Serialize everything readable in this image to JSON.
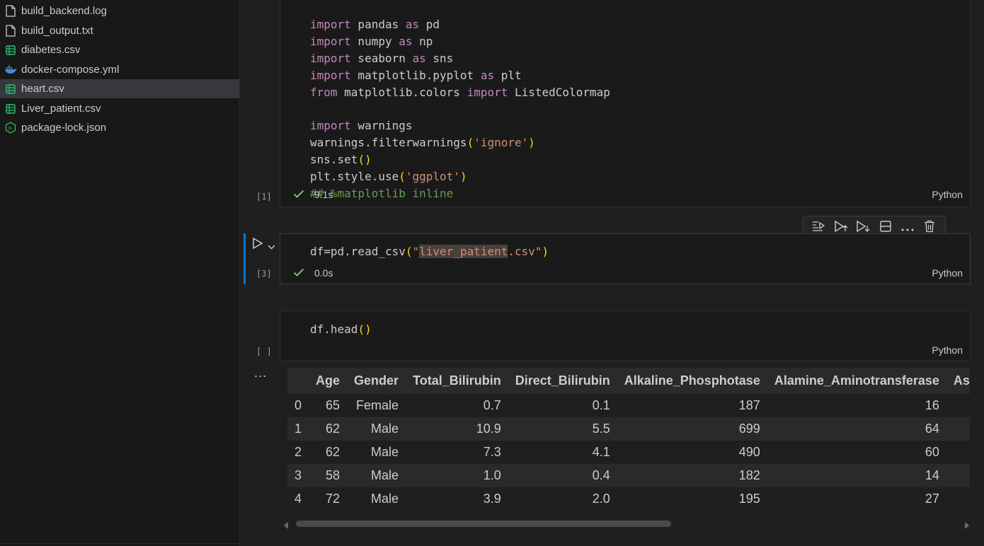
{
  "explorer": {
    "files": [
      {
        "name": "build_backend.log",
        "icon": "file-icon"
      },
      {
        "name": "build_output.txt",
        "icon": "file-icon"
      },
      {
        "name": "diabetes.csv",
        "icon": "csv-icon"
      },
      {
        "name": "docker-compose.yml",
        "icon": "docker-icon"
      },
      {
        "name": "heart.csv",
        "icon": "csv-icon",
        "selected": true
      },
      {
        "name": "Liver_patient.csv",
        "icon": "csv-icon"
      },
      {
        "name": "package-lock.json",
        "icon": "json-icon"
      }
    ]
  },
  "cells": [
    {
      "exec_count": "[1]",
      "lines": [
        "import pandas as pd",
        "import numpy as np",
        "import seaborn as sns",
        "import matplotlib.pyplot as plt",
        "from matplotlib.colors import ListedColormap",
        "",
        "import warnings",
        "warnings.filterwarnings('ignore')",
        "sns.set()",
        "plt.style.use('ggplot')",
        "## %matplotlib inline"
      ],
      "status": "9.1s",
      "language": "Python"
    },
    {
      "exec_count": "[3]",
      "lines": [
        "df=pd.read_csv(\"liver_patient.csv\")"
      ],
      "status": "0.0s",
      "language": "Python"
    },
    {
      "exec_count": "[ ]",
      "lines": [
        "df.head()"
      ],
      "language": "Python"
    }
  ],
  "output_more": "...",
  "output_table": {
    "columns": [
      "",
      "Age",
      "Gender",
      "Total_Bilirubin",
      "Direct_Bilirubin",
      "Alkaline_Phosphotase",
      "Alamine_Aminotransferase",
      "Aspartat"
    ],
    "rows": [
      [
        "0",
        "65",
        "Female",
        "0.7",
        "0.1",
        "187",
        "16",
        ""
      ],
      [
        "1",
        "62",
        "Male",
        "10.9",
        "5.5",
        "699",
        "64",
        ""
      ],
      [
        "2",
        "62",
        "Male",
        "7.3",
        "4.1",
        "490",
        "60",
        ""
      ],
      [
        "3",
        "58",
        "Male",
        "1.0",
        "0.4",
        "182",
        "14",
        ""
      ],
      [
        "4",
        "72",
        "Male",
        "3.9",
        "2.0",
        "195",
        "27",
        ""
      ]
    ]
  },
  "colors": {
    "accent": "#0078d4",
    "success": "#89d185",
    "keyword": "#c586c0",
    "string": "#ce9178",
    "bracket": "#ffd700",
    "comment": "#6a9955"
  }
}
